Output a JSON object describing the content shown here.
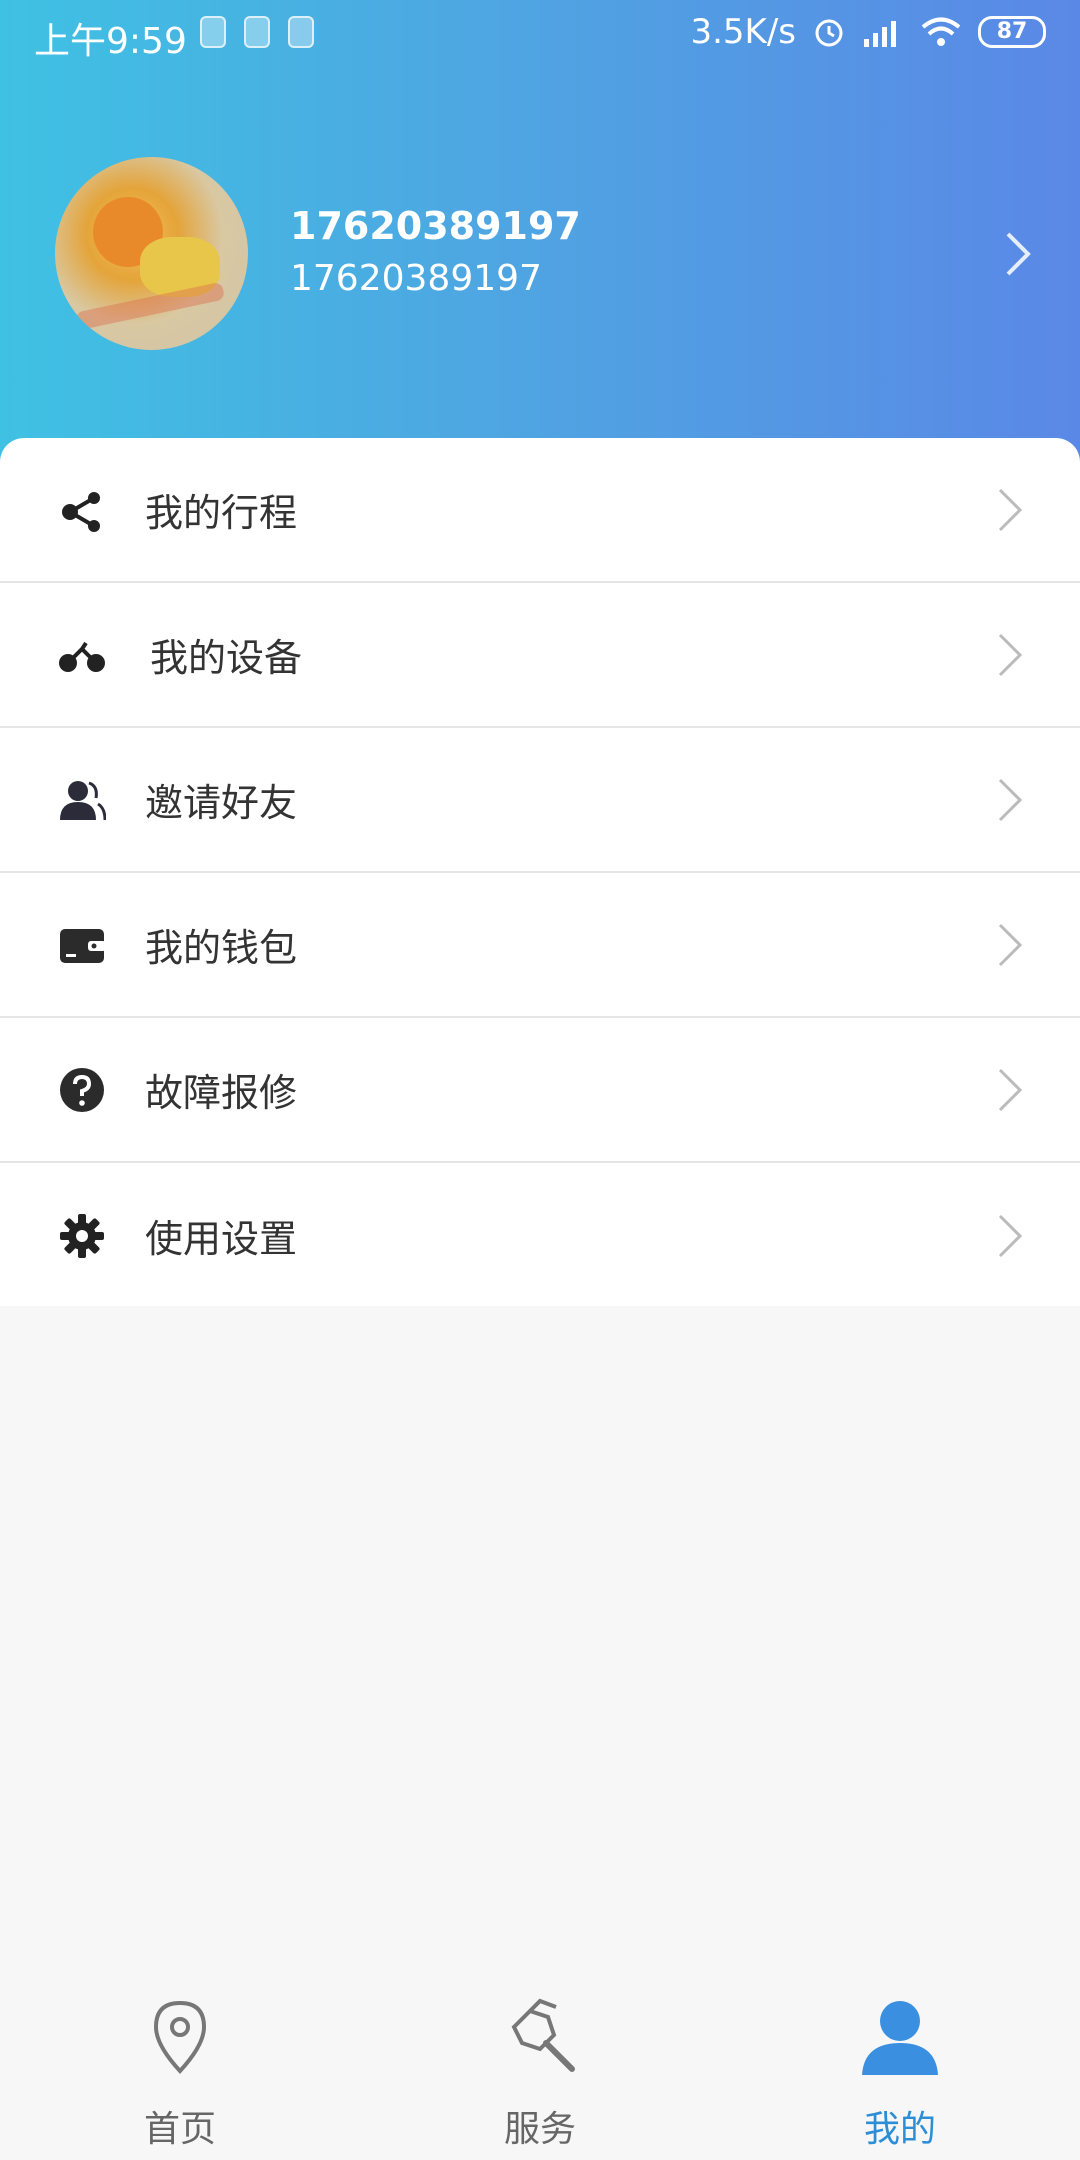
{
  "status_bar": {
    "time": "上午9:59",
    "speed": "3.5K/s",
    "battery": "87"
  },
  "profile": {
    "name": "17620389197",
    "phone": "17620389197"
  },
  "menu": [
    {
      "label": "我的行程",
      "icon": "share-icon"
    },
    {
      "label": "我的设备",
      "icon": "bicycle-icon"
    },
    {
      "label": "邀请好友",
      "icon": "users-icon"
    },
    {
      "label": "我的钱包",
      "icon": "wallet-icon"
    },
    {
      "label": "故障报修",
      "icon": "question-icon"
    },
    {
      "label": "使用设置",
      "icon": "gear-icon"
    }
  ],
  "tabs": [
    {
      "label": "首页",
      "icon": "location-pin-icon"
    },
    {
      "label": "服务",
      "icon": "wrench-icon"
    },
    {
      "label": "我的",
      "icon": "person-icon"
    }
  ],
  "colors": {
    "accent": "#2c8fd6",
    "header_start": "#3fc1e3",
    "header_end": "#5a88e6"
  }
}
